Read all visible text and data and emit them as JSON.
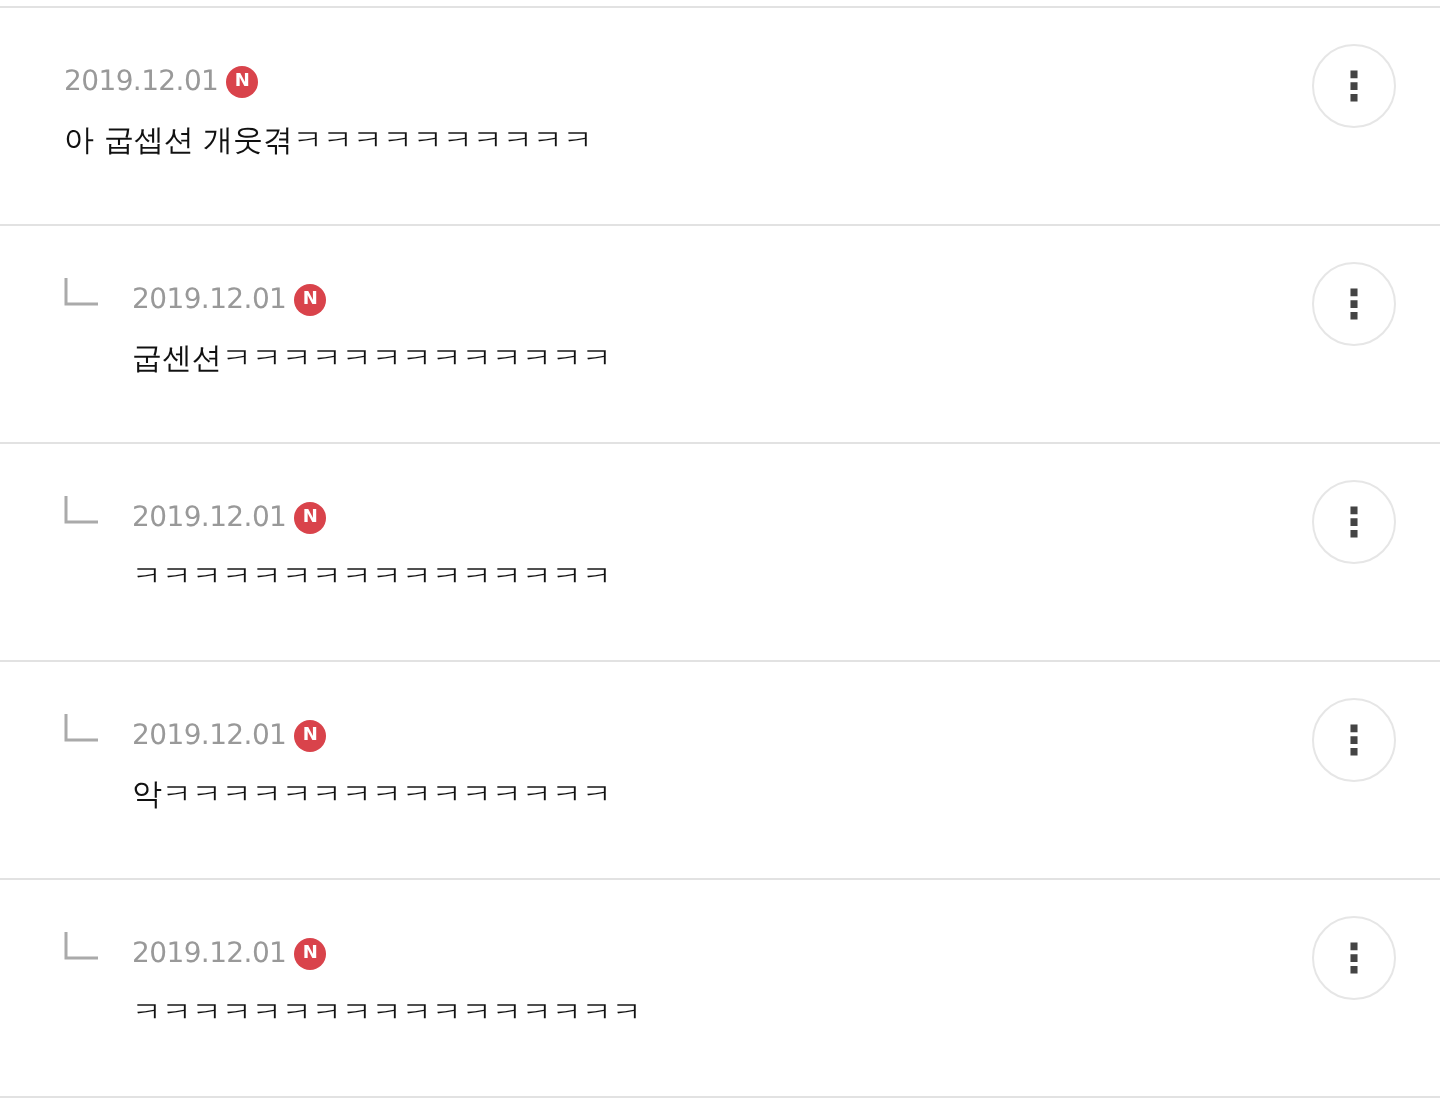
{
  "comments": [
    {
      "kind": "comment",
      "date": "2019.12.01",
      "badge": "N",
      "text": "아 굽셉션 개웃겪ㅋㅋㅋㅋㅋㅋㅋㅋㅋㅋ",
      "more_label": "⋮"
    },
    {
      "kind": "reply",
      "date": "2019.12.01",
      "badge": "N",
      "text": "굽센션ㅋㅋㅋㅋㅋㅋㅋㅋㅋㅋㅋㅋㅋ",
      "more_label": "⋮"
    },
    {
      "kind": "reply",
      "date": "2019.12.01",
      "badge": "N",
      "text": "ㅋㅋㅋㅋㅋㅋㅋㅋㅋㅋㅋㅋㅋㅋㅋㅋ",
      "more_label": "⋮"
    },
    {
      "kind": "reply",
      "date": "2019.12.01",
      "badge": "N",
      "text": "악ㅋㅋㅋㅋㅋㅋㅋㅋㅋㅋㅋㅋㅋㅋㅋ",
      "more_label": "⋮"
    },
    {
      "kind": "reply",
      "date": "2019.12.01",
      "badge": "N",
      "text": "ㅋㅋㅋㅋㅋㅋㅋㅋㅋㅋㅋㅋㅋㅋㅋㅋㅋ",
      "more_label": "⋮"
    }
  ]
}
